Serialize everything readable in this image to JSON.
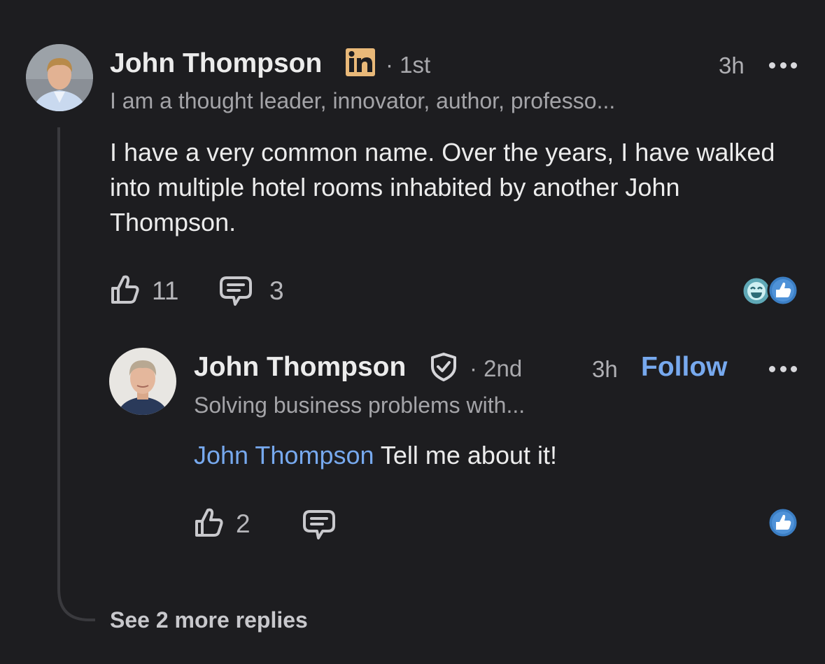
{
  "comment": {
    "author": {
      "name": "John Thompson",
      "badge_icon": "linkedin-icon",
      "degree": "· 1st",
      "headline": "I am a thought leader, innovator, author, professo..."
    },
    "time": "3h",
    "text": "I have a very common name.  Over the years, I have walked into multiple hotel rooms inhabited by another John Thompson.",
    "likes": "11",
    "replies": "3",
    "reaction_icons": [
      "funny-reaction-icon",
      "like-reaction-icon"
    ]
  },
  "reply": {
    "author": {
      "name": "John Thompson",
      "badge_icon": "verified-shield-icon",
      "degree": "· 2nd",
      "headline": "Solving business problems with..."
    },
    "time": "3h",
    "follow_label": "Follow",
    "mention": "John Thompson",
    "text": " Tell me about it!",
    "likes": "2",
    "reaction_icons": [
      "like-reaction-icon"
    ]
  },
  "see_more_label": "See 2 more replies",
  "colors": {
    "background": "#1d1d20",
    "accent": "#77a9ee",
    "linkedin_badge": "#e9b979",
    "thread_line": "#3a3a3e"
  }
}
